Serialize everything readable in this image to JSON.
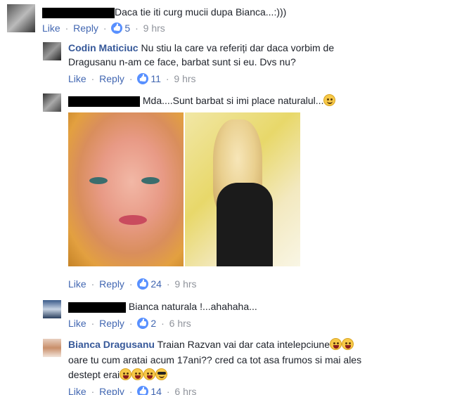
{
  "comments": [
    {
      "author": "",
      "text": "Daca tie iti curg mucii dupa Bianca...:)))",
      "actions": {
        "like": "Like",
        "reply": "Reply",
        "count": "5",
        "time": "9 hrs"
      }
    },
    {
      "author": "Codin Maticiuc",
      "text_line1": "Nu stiu la care va referiți dar daca vorbim de",
      "text_line2": "Dragusanu n-am ce face, barbat sunt si eu. Dvs nu?",
      "actions": {
        "like": "Like",
        "reply": "Reply",
        "count": "11",
        "time": "9 hrs"
      }
    },
    {
      "author": "",
      "text": "Mda....Sunt barbat si imi place naturalul...",
      "actions": {
        "like": "Like",
        "reply": "Reply",
        "count": "24",
        "time": "9 hrs"
      }
    },
    {
      "author": "",
      "text": "Bianca naturala !...ahahaha...",
      "actions": {
        "like": "Like",
        "reply": "Reply",
        "count": "2",
        "time": "6 hrs"
      }
    },
    {
      "author": "Bianca Dragusanu",
      "text_line1": "Traian Razvan vai dar cata intelepciune",
      "text_line2": "oare tu cum aratai acum 17ani?? cred ca tot asa frumos si mai ales",
      "text_line3": "destept erai",
      "actions": {
        "like": "Like",
        "reply": "Reply",
        "count": "14",
        "time": "6 hrs"
      }
    }
  ],
  "separator": " · ",
  "colors": {
    "link": "#4267b2",
    "name": "#365899",
    "meta": "#90949c",
    "badge": "#5890ff"
  },
  "icons": [
    "like-reaction-icon",
    "smile-emoji-icon",
    "laughing-emoji-icon",
    "cool-emoji-icon"
  ]
}
